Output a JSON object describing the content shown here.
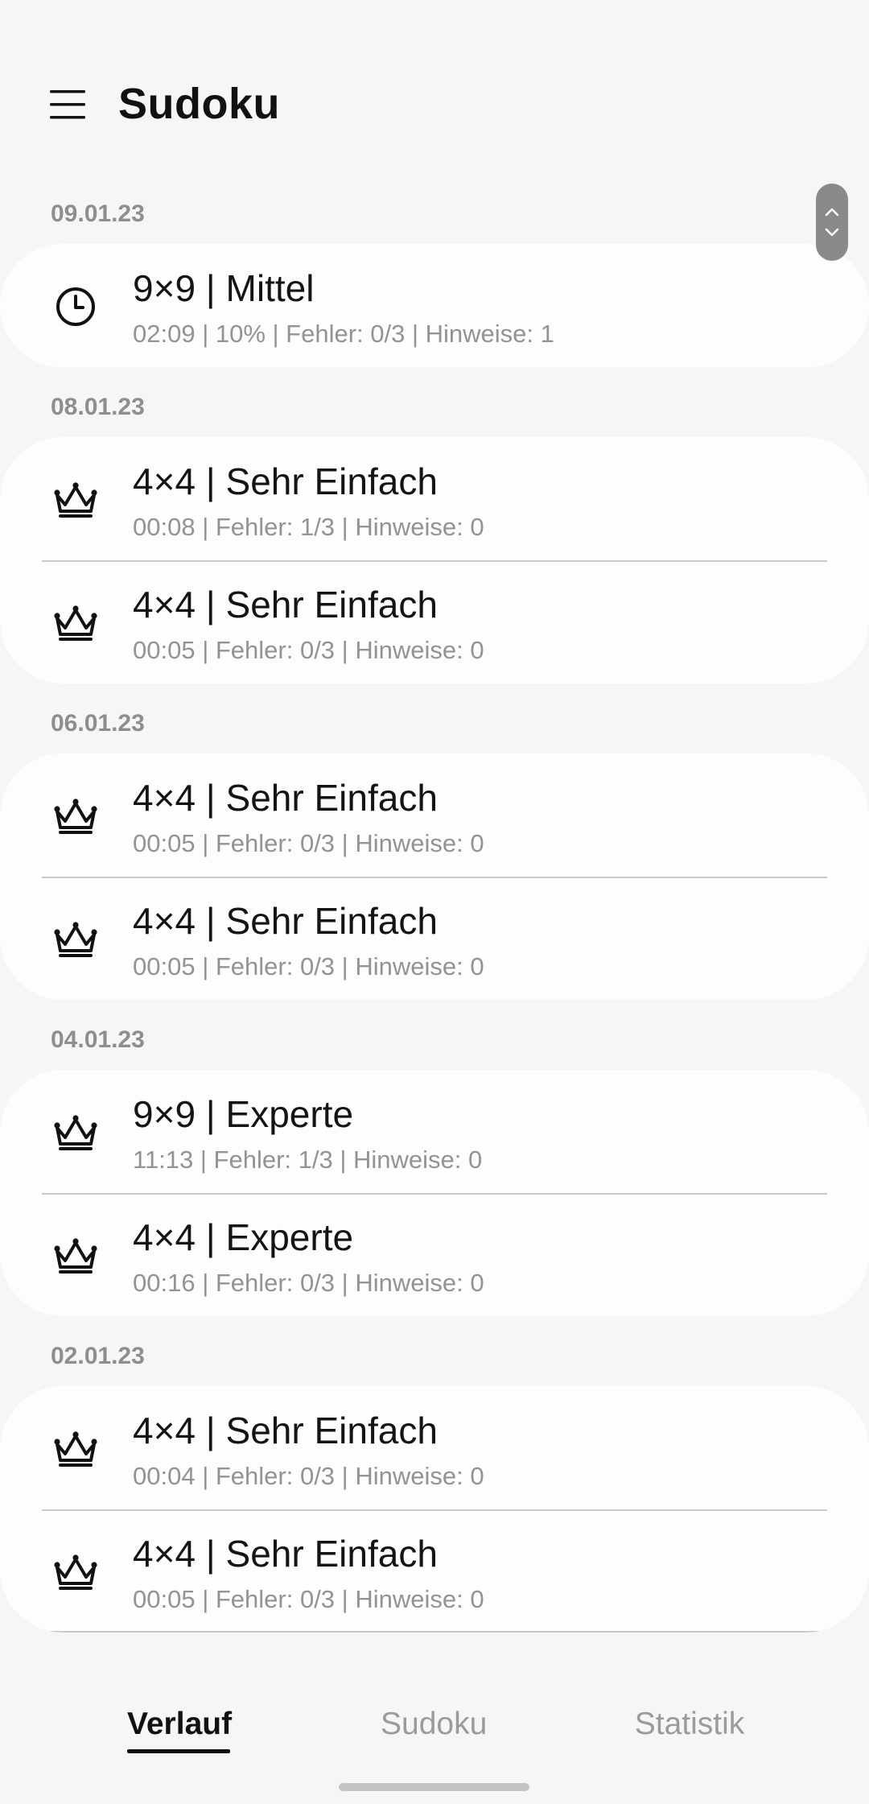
{
  "header": {
    "title": "Sudoku",
    "menu_icon": "hamburger-icon"
  },
  "history": {
    "groups": [
      {
        "date": "09.01.23",
        "entries": [
          {
            "icon": "clock-icon",
            "title": "9×9 | Mittel",
            "details": "02:09 | 10% | Fehler: 0/3 | Hinweise: 1"
          }
        ]
      },
      {
        "date": "08.01.23",
        "entries": [
          {
            "icon": "crown-icon",
            "title": "4×4 | Sehr Einfach",
            "details": "00:08 | Fehler: 1/3 | Hinweise: 0"
          },
          {
            "icon": "crown-icon",
            "title": "4×4 | Sehr Einfach",
            "details": "00:05 | Fehler: 0/3 | Hinweise: 0"
          }
        ]
      },
      {
        "date": "06.01.23",
        "entries": [
          {
            "icon": "crown-icon",
            "title": "4×4 | Sehr Einfach",
            "details": "00:05 | Fehler: 0/3 | Hinweise: 0"
          },
          {
            "icon": "crown-icon",
            "title": "4×4 | Sehr Einfach",
            "details": "00:05 | Fehler: 0/3 | Hinweise: 0"
          }
        ]
      },
      {
        "date": "04.01.23",
        "entries": [
          {
            "icon": "crown-icon",
            "title": "9×9 | Experte",
            "details": "11:13 | Fehler: 1/3 | Hinweise: 0"
          },
          {
            "icon": "crown-icon",
            "title": "4×4 | Experte",
            "details": "00:16 | Fehler: 0/3 | Hinweise: 0"
          }
        ]
      },
      {
        "date": "02.01.23",
        "entries": [
          {
            "icon": "crown-icon",
            "title": "4×4 | Sehr Einfach",
            "details": "00:04 | Fehler: 0/3 | Hinweise: 0"
          },
          {
            "icon": "crown-icon",
            "title": "4×4 | Sehr Einfach",
            "details": "00:05 | Fehler: 0/3 | Hinweise: 0"
          }
        ],
        "continues": true
      }
    ]
  },
  "bottom_nav": {
    "tabs": [
      {
        "label": "Verlauf",
        "active": true
      },
      {
        "label": "Sudoku",
        "active": false
      },
      {
        "label": "Statistik",
        "active": false
      }
    ]
  },
  "colors": {
    "background": "#f6f6f6",
    "card": "#fdfdfd",
    "secondary_text": "#939393",
    "scroll_handle": "#8a8a8a"
  }
}
